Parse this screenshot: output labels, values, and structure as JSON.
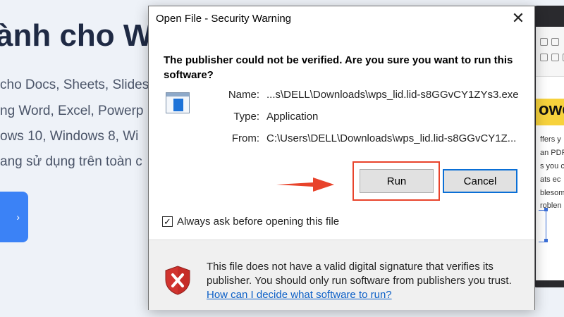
{
  "background_page": {
    "heading": "ành cho W",
    "lines": [
      "cho Docs, Sheets, Slides",
      "ng Word, Excel, Powerp",
      "ows 10, Windows 8, Wi",
      "ang sử dụng trên toàn c"
    ],
    "button_arrow": "›",
    "side_preview": {
      "banner_text": "owe",
      "lines": [
        "ffers y",
        "an PDF",
        "s you c",
        "ats ec",
        "blesom",
        "roblen"
      ]
    }
  },
  "dialog": {
    "title": "Open File - Security Warning",
    "close_glyph": "✕",
    "headline": "The publisher could not be verified.  Are you sure you want to run this software?",
    "file_info": {
      "name_label": "Name:",
      "name_value": "...s\\DELL\\Downloads\\wps_lid.lid-s8GGvCY1ZYs3.exe",
      "type_label": "Type:",
      "type_value": "Application",
      "from_label": "From:",
      "from_value": "C:\\Users\\DELL\\Downloads\\wps_lid.lid-s8GGvCY1Z..."
    },
    "buttons": {
      "run": "Run",
      "cancel": "Cancel"
    },
    "checkbox": {
      "label": "Always ask before opening this file",
      "checked": true,
      "glyph": "✓"
    },
    "footer": {
      "text": "This file does not have a valid digital signature that verifies its publisher.  You should only run software from publishers you trust.",
      "link": "How can I decide what software to run?"
    }
  },
  "colors": {
    "highlight": "#e8432b",
    "accent": "#0a6fd6",
    "link": "#0b5fc7",
    "shield": "#d1342f"
  }
}
